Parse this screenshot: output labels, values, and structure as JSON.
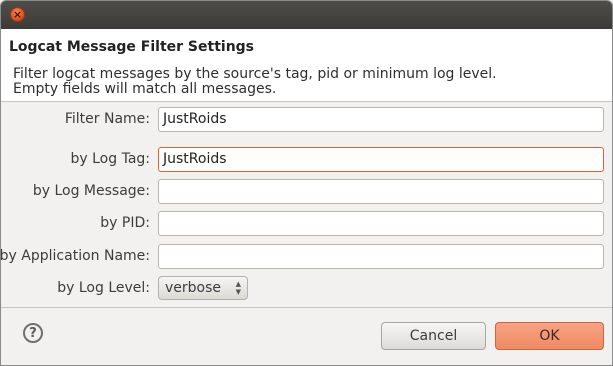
{
  "window": {
    "close_glyph": "×"
  },
  "header": {
    "title": "Logcat Message Filter Settings",
    "description_line1": "Filter logcat messages by the source's tag, pid or minimum log level.",
    "description_line2": "Empty fields will match all messages."
  },
  "form": {
    "filter_name": {
      "label": "Filter Name:",
      "value": "JustRoids"
    },
    "log_tag": {
      "label": "by Log Tag:",
      "value": "JustRoids"
    },
    "log_message": {
      "label": "by Log Message:",
      "value": ""
    },
    "pid": {
      "label": "by PID:",
      "value": ""
    },
    "app_name": {
      "label": "by Application Name:",
      "value": ""
    },
    "log_level": {
      "label": "by Log Level:",
      "value": "verbose"
    }
  },
  "footer": {
    "help_glyph": "?",
    "cancel_label": "Cancel",
    "ok_label": "OK"
  },
  "colors": {
    "accent": "#e2622c",
    "ok_button": "#ef8a62",
    "titlebar": "#3c3b37"
  },
  "icons": [
    "close-icon",
    "help-icon",
    "select-arrows-icon"
  ]
}
